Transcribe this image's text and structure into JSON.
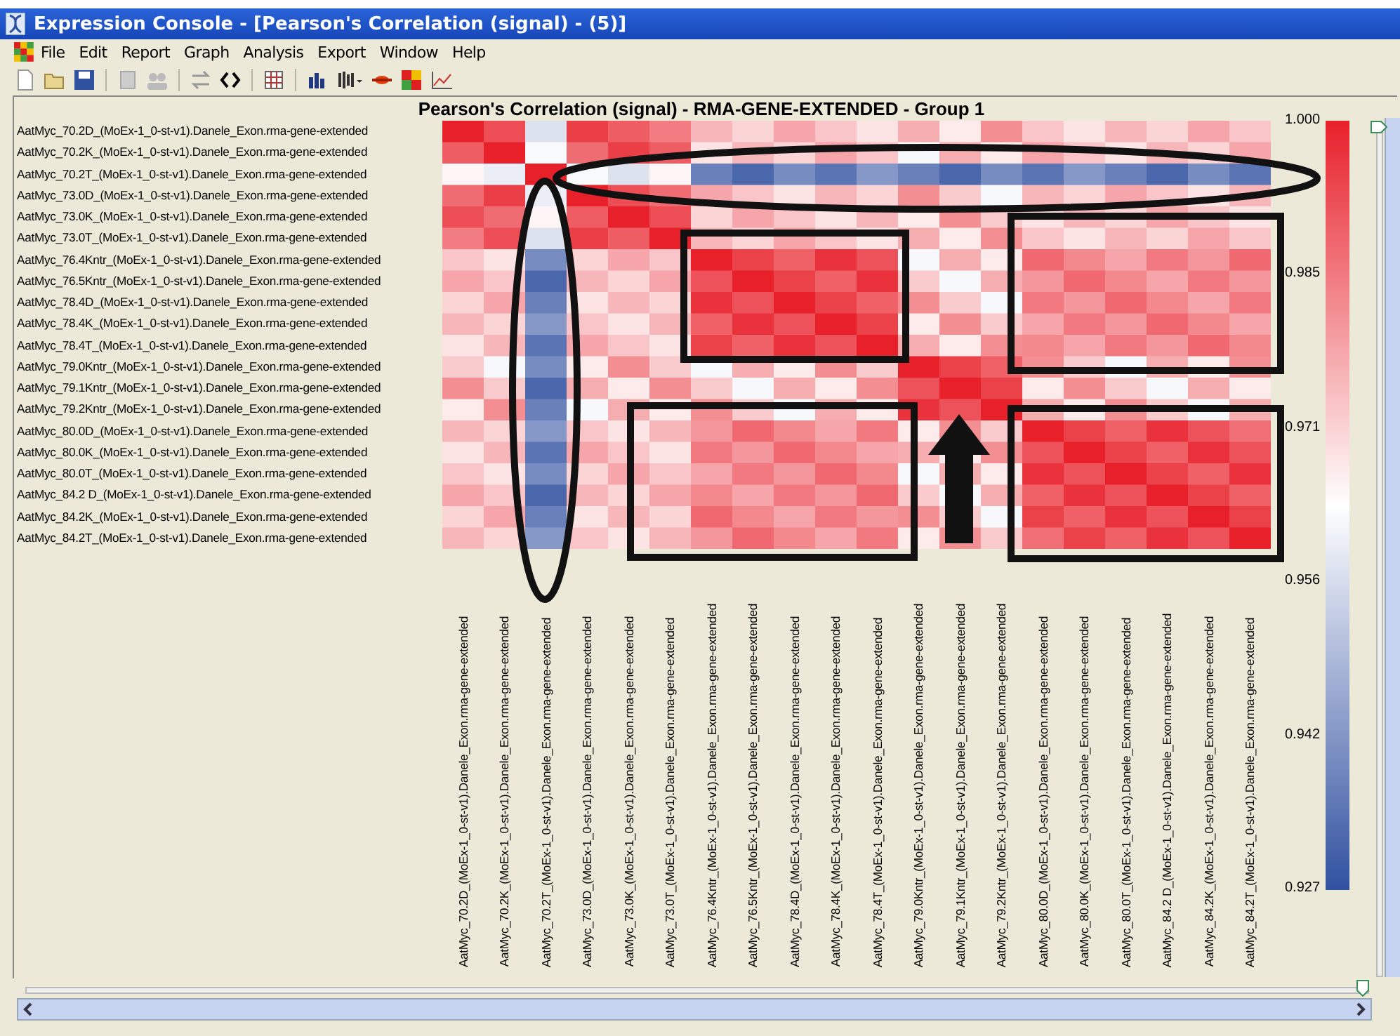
{
  "window": {
    "title": "Expression Console - [Pearson's Correlation (signal) - (5)]"
  },
  "menu": [
    "File",
    "Edit",
    "Report",
    "Graph",
    "Analysis",
    "Export",
    "Window",
    "Help"
  ],
  "chart": {
    "title": "Pearson's Correlation (signal) - RMA-GENE-EXTENDED - Group 1",
    "rows": [
      "AatMyc_70.2D_(MoEx-1_0-st-v1).Danele_Exon.rma-gene-extended",
      "AatMyc_70.2K_(MoEx-1_0-st-v1).Danele_Exon.rma-gene-extended",
      "AatMyc_70.2T_(MoEx-1_0-st-v1).Danele_Exon.rma-gene-extended",
      "AatMyc_73.0D_(MoEx-1_0-st-v1).Danele_Exon.rma-gene-extended",
      "AatMyc_73.0K_(MoEx-1_0-st-v1).Danele_Exon.rma-gene-extended",
      "AatMyc_73.0T_(MoEx-1_0-st-v1).Danele_Exon.rma-gene-extended",
      "AatMyc_76.4Kntr_(MoEx-1_0-st-v1).Danele_Exon.rma-gene-extended",
      "AatMyc_76.5Kntr_(MoEx-1_0-st-v1).Danele_Exon.rma-gene-extended",
      "AatMyc_78.4D_(MoEx-1_0-st-v1).Danele_Exon.rma-gene-extended",
      "AatMyc_78.4K_(MoEx-1_0-st-v1).Danele_Exon.rma-gene-extended",
      "AatMyc_78.4T_(MoEx-1_0-st-v1).Danele_Exon.rma-gene-extended",
      "AatMyc_79.0Kntr_(MoEx-1_0-st-v1).Danele_Exon.rma-gene-extended",
      "AatMyc_79.1Kntr_(MoEx-1_0-st-v1).Danele_Exon.rma-gene-extended",
      "AatMyc_79.2Kntr_(MoEx-1_0-st-v1).Danele_Exon.rma-gene-extended",
      "AatMyc_80.0D_(MoEx-1_0-st-v1).Danele_Exon.rma-gene-extended",
      "AatMyc_80.0K_(MoEx-1_0-st-v1).Danele_Exon.rma-gene-extended",
      "AatMyc_80.0T_(MoEx-1_0-st-v1).Danele_Exon.rma-gene-extended",
      "AatMyc_84.2 D_(MoEx-1_0-st-v1).Danele_Exon.rma-gene-extended",
      "AatMyc_84.2K_(MoEx-1_0-st-v1).Danele_Exon.rma-gene-extended",
      "AatMyc_84.2T_(MoEx-1_0-st-v1).Danele_Exon.rma-gene-extended"
    ],
    "columns": [
      "AatMyc_70.2D_(MoEx-1_0-st-v1).Danele_Exon.rma-gene-extended",
      "AatMyc_70.2K_(MoEx-1_0-st-v1).Danele_Exon.rma-gene-extended",
      "AatMyc_70.2T_(MoEx-1_0-st-v1).Danele_Exon.rma-gene-extended",
      "AatMyc_73.0D_(MoEx-1_0-st-v1).Danele_Exon.rma-gene-extended",
      "AatMyc_73.0K_(MoEx-1_0-st-v1).Danele_Exon.rma-gene-extended",
      "AatMyc_73.0T_(MoEx-1_0-st-v1).Danele_Exon.rma-gene-extended",
      "AatMyc_76.4Kntr_(MoEx-1_0-st-v1).Danele_Exon.rma-gene-extended",
      "AatMyc_76.5Kntr_(MoEx-1_0-st-v1).Danele_Exon.rma-gene-extended",
      "AatMyc_78.4D_(MoEx-1_0-st-v1).Danele_Exon.rma-gene-extended",
      "AatMyc_78.4K_(MoEx-1_0-st-v1).Danele_Exon.rma-gene-extended",
      "AatMyc_78.4T_(MoEx-1_0-st-v1).Danele_Exon.rma-gene-extended",
      "AatMyc_79.0Kntr_(MoEx-1_0-st-v1).Danele_Exon.rma-gene-extended",
      "AatMyc_79.1Kntr_(MoEx-1_0-st-v1).Danele_Exon.rma-gene-extended",
      "AatMyc_79.2Kntr_(MoEx-1_0-st-v1).Danele_Exon.rma-gene-extended",
      "AatMyc_80.0D_(MoEx-1_0-st-v1).Danele_Exon.rma-gene-extended",
      "AatMyc_80.0K_(MoEx-1_0-st-v1).Danele_Exon.rma-gene-extended",
      "AatMyc_80.0T_(MoEx-1_0-st-v1).Danele_Exon.rma-gene-extended",
      "AatMyc_84.2 D_(MoEx-1_0-st-v1).Danele_Exon.rma-gene-extended",
      "AatMyc_84.2K_(MoEx-1_0-st-v1).Danele_Exon.rma-gene-extended",
      "AatMyc_84.2T_(MoEx-1_0-st-v1).Danele_Exon.rma-gene-extended"
    ],
    "scale_labels": [
      "1.000",
      "0.985",
      "0.971",
      "0.956",
      "0.942",
      "0.927"
    ]
  },
  "vertical_slider": {
    "level": 1
  },
  "horizontal_slider": {
    "level": 1
  }
}
